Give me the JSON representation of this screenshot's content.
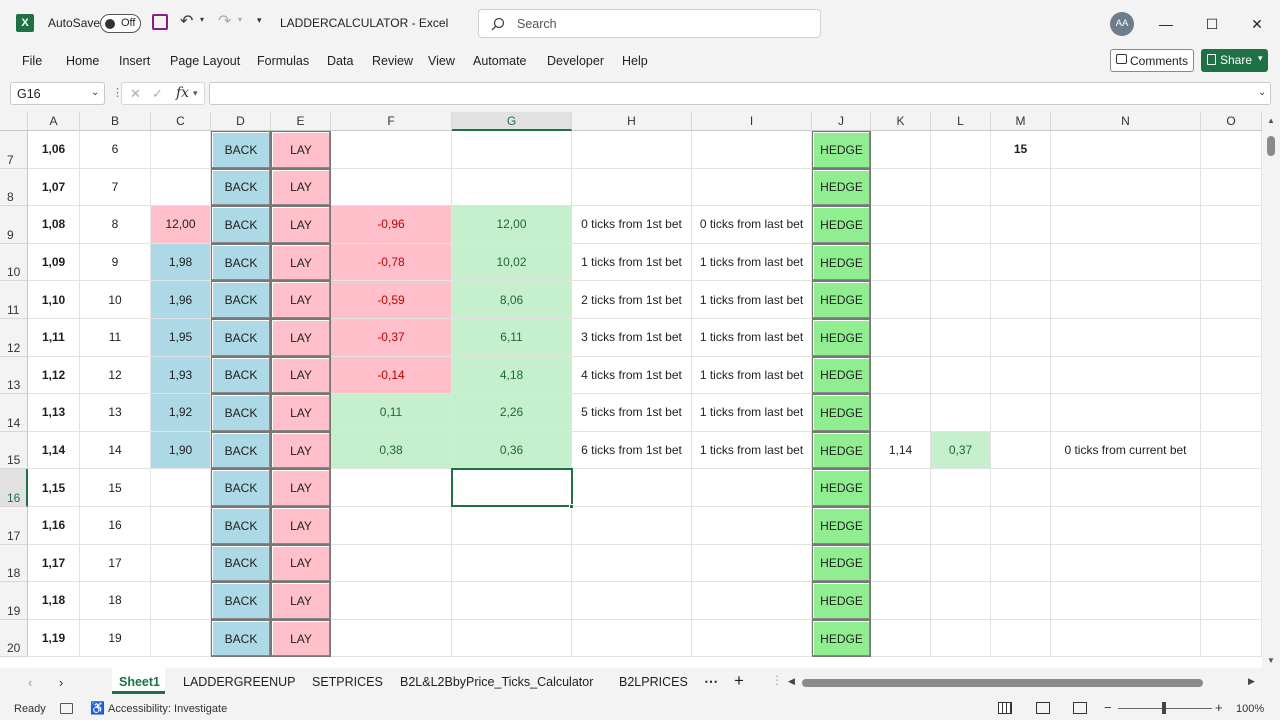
{
  "titlebar": {
    "autosave_label": "AutoSave",
    "autosave_state": "Off",
    "title": "LADDERCALCULATOR  -  Excel",
    "search_placeholder": "Search",
    "user_initials": "AA"
  },
  "menu": [
    "File",
    "Home",
    "Insert",
    "Page Layout",
    "Formulas",
    "Data",
    "Review",
    "View",
    "Automate",
    "Developer",
    "Help"
  ],
  "buttons": {
    "comments": "Comments",
    "share": "Share"
  },
  "formula_bar": {
    "name_box": "G16",
    "formula": ""
  },
  "columns": [
    "A",
    "B",
    "C",
    "D",
    "E",
    "F",
    "G",
    "H",
    "I",
    "J",
    "K",
    "L",
    "M",
    "N",
    "O"
  ],
  "rows": [
    {
      "n": "7",
      "A": "1,06",
      "B": "6",
      "C": "",
      "D": "BACK",
      "E": "LAY",
      "F": "",
      "G": "",
      "H": "",
      "I": "",
      "J": "HEDGE",
      "K": "",
      "L": "",
      "M": "15",
      "N": ""
    },
    {
      "n": "8",
      "A": "1,07",
      "B": "7",
      "C": "",
      "D": "BACK",
      "E": "LAY",
      "F": "",
      "G": "",
      "H": "",
      "I": "",
      "J": "HEDGE",
      "K": "",
      "L": "",
      "M": "",
      "N": ""
    },
    {
      "n": "9",
      "A": "1,08",
      "B": "8",
      "C": "12,00",
      "D": "BACK",
      "E": "LAY",
      "F": "-0,96",
      "G": "12,00",
      "H": "0 ticks from 1st bet",
      "I": "0 ticks from last bet",
      "J": "HEDGE",
      "K": "",
      "L": "",
      "M": "",
      "N": ""
    },
    {
      "n": "10",
      "A": "1,09",
      "B": "9",
      "C": "1,98",
      "D": "BACK",
      "E": "LAY",
      "F": "-0,78",
      "G": "10,02",
      "H": "1 ticks from 1st bet",
      "I": "1 ticks from last bet",
      "J": "HEDGE",
      "K": "",
      "L": "",
      "M": "",
      "N": ""
    },
    {
      "n": "11",
      "A": "1,10",
      "B": "10",
      "C": "1,96",
      "D": "BACK",
      "E": "LAY",
      "F": "-0,59",
      "G": "8,06",
      "H": "2 ticks from 1st bet",
      "I": "1 ticks from last bet",
      "J": "HEDGE",
      "K": "",
      "L": "",
      "M": "",
      "N": ""
    },
    {
      "n": "12",
      "A": "1,11",
      "B": "11",
      "C": "1,95",
      "D": "BACK",
      "E": "LAY",
      "F": "-0,37",
      "G": "6,11",
      "H": "3 ticks from 1st bet",
      "I": "1 ticks from last bet",
      "J": "HEDGE",
      "K": "",
      "L": "",
      "M": "",
      "N": ""
    },
    {
      "n": "13",
      "A": "1,12",
      "B": "12",
      "C": "1,93",
      "D": "BACK",
      "E": "LAY",
      "F": "-0,14",
      "G": "4,18",
      "H": "4 ticks from 1st bet",
      "I": "1 ticks from last bet",
      "J": "HEDGE",
      "K": "",
      "L": "",
      "M": "",
      "N": ""
    },
    {
      "n": "14",
      "A": "1,13",
      "B": "13",
      "C": "1,92",
      "D": "BACK",
      "E": "LAY",
      "F": "0,11",
      "G": "2,26",
      "H": "5 ticks from 1st bet",
      "I": "1 ticks from last bet",
      "J": "HEDGE",
      "K": "",
      "L": "",
      "M": "",
      "N": ""
    },
    {
      "n": "15",
      "A": "1,14",
      "B": "14",
      "C": "1,90",
      "D": "BACK",
      "E": "LAY",
      "F": "0,38",
      "G": "0,36",
      "H": "6 ticks from 1st bet",
      "I": "1 ticks from last bet",
      "J": "HEDGE",
      "K": "1,14",
      "L": "0,37",
      "M": "",
      "N": "0 ticks from current bet"
    },
    {
      "n": "16",
      "A": "1,15",
      "B": "15",
      "C": "",
      "D": "BACK",
      "E": "LAY",
      "F": "",
      "G": "",
      "H": "",
      "I": "",
      "J": "HEDGE",
      "K": "",
      "L": "",
      "M": "",
      "N": ""
    },
    {
      "n": "17",
      "A": "1,16",
      "B": "16",
      "C": "",
      "D": "BACK",
      "E": "LAY",
      "F": "",
      "G": "",
      "H": "",
      "I": "",
      "J": "HEDGE",
      "K": "",
      "L": "",
      "M": "",
      "N": ""
    },
    {
      "n": "18",
      "A": "1,17",
      "B": "17",
      "C": "",
      "D": "BACK",
      "E": "LAY",
      "F": "",
      "G": "",
      "H": "",
      "I": "",
      "J": "HEDGE",
      "K": "",
      "L": "",
      "M": "",
      "N": ""
    },
    {
      "n": "19",
      "A": "1,18",
      "B": "18",
      "C": "",
      "D": "BACK",
      "E": "LAY",
      "F": "",
      "G": "",
      "H": "",
      "I": "",
      "J": "HEDGE",
      "K": "",
      "L": "",
      "M": "",
      "N": ""
    },
    {
      "n": "20",
      "A": "1,19",
      "B": "19",
      "C": "",
      "D": "BACK",
      "E": "LAY",
      "F": "",
      "G": "",
      "H": "",
      "I": "",
      "J": "HEDGE",
      "K": "",
      "L": "",
      "M": "",
      "N": ""
    }
  ],
  "sheet_tabs": [
    "Sheet1",
    "LADDERGREENUP",
    "SETPRICES",
    "B2L&L2BbyPrice_Ticks_Calculator",
    "B2LPRICES"
  ],
  "active_sheet": "Sheet1",
  "status": {
    "ready": "Ready",
    "accessibility": "Accessibility: Investigate",
    "zoom": "100%"
  },
  "colors": {
    "back": "#add8e6",
    "lay": "#ffc0cb",
    "hedge": "#90ee90",
    "profit": "#c6efce",
    "accent": "#1e7145"
  }
}
